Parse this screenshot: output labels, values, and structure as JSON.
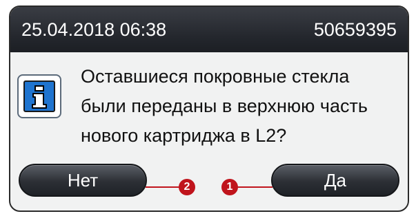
{
  "header": {
    "datetime": "25.04.2018 06:38",
    "serial": "50659395"
  },
  "icon": "info-icon",
  "message": {
    "lines": [
      "Оставшиеся покровные стекла",
      "были переданы в верхнюю часть",
      "нового картриджа в L2?"
    ]
  },
  "buttons": {
    "no_label": "Нет",
    "yes_label": "Да"
  },
  "callouts": {
    "no": "2",
    "yes": "1"
  },
  "colors": {
    "title_bar": "#23262c",
    "dialog_bg": "#f1f2f2",
    "info_blue": "#1f74cf",
    "callout_red": "#c0141c"
  }
}
